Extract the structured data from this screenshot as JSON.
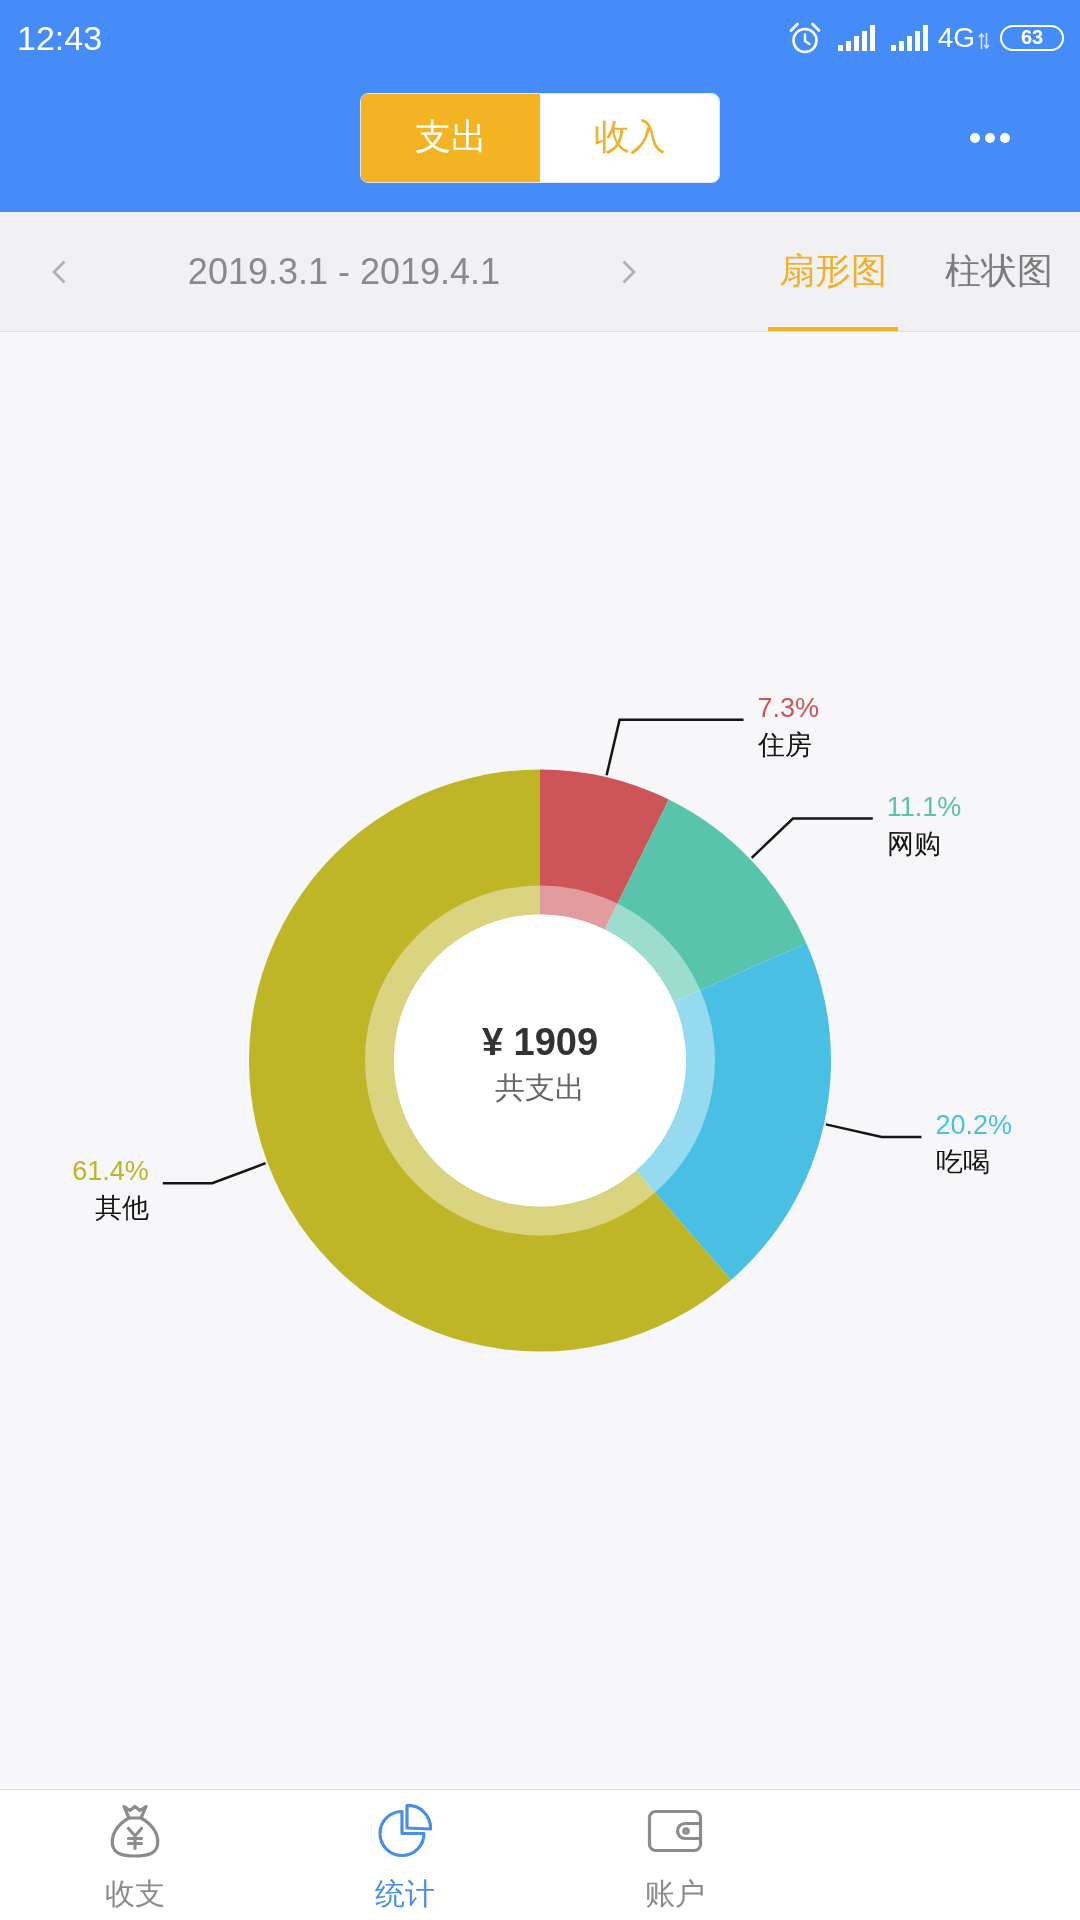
{
  "status_bar": {
    "time": "12:43",
    "network": "4G",
    "battery": "63"
  },
  "header": {
    "segments": [
      {
        "label": "支出",
        "selected": true
      },
      {
        "label": "收入",
        "selected": false
      }
    ]
  },
  "toolbar": {
    "date_range": "2019.3.1 - 2019.4.1",
    "chart_tabs": [
      {
        "label": "扇形图",
        "selected": true
      },
      {
        "label": "柱状图",
        "selected": false
      }
    ]
  },
  "chart": {
    "center_amount": "¥ 1909",
    "center_caption": "共支出",
    "chart_data": {
      "type": "donut",
      "categories": [
        "住房",
        "网购",
        "吃喝",
        "其他"
      ],
      "values": [
        7.3,
        11.1,
        20.2,
        61.4
      ],
      "colors": [
        "#cd5557",
        "#57c4ab",
        "#49c0e3",
        "#bfb627"
      ],
      "value_labels": [
        "7.3%",
        "11.1%",
        "20.2%",
        "61.4%"
      ]
    }
  },
  "bottom_nav": [
    {
      "label": "收支",
      "selected": false
    },
    {
      "label": "统计",
      "selected": true
    },
    {
      "label": "账户",
      "selected": false
    }
  ]
}
